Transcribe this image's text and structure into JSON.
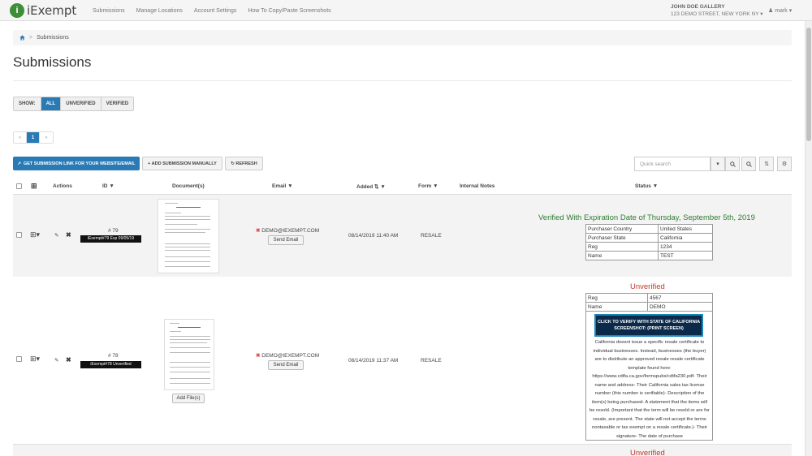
{
  "header": {
    "logo_text": "iExempt",
    "logo_letter": "i",
    "nav": [
      "Submissions",
      "Manage Locations",
      "Account Settings",
      "How To Copy/Paste Screenshots"
    ],
    "gallery_name": "JOHN DOE GALLERY",
    "gallery_address": "123 DEMO STREET, NEW YORK NY ▾",
    "user": "mark ▾"
  },
  "breadcrumb": {
    "current": "Submissions"
  },
  "page_title": "Submissions",
  "filter": {
    "show_label": "SHOW:",
    "options": [
      "ALL",
      "UNVERIFIED",
      "VERIFIED"
    ],
    "active": "ALL"
  },
  "pager": {
    "prev": "«",
    "page": "1",
    "next": "»"
  },
  "toolbar": {
    "get_link": "GET SUBMISSION LINK FOR YOUR WEBSITE/EMAIL",
    "add_manual": "+ ADD SUBMISSION MANUALLY",
    "refresh": "↻ REFRESH",
    "search_placeholder": "Quick search"
  },
  "columns": {
    "actions": "Actions",
    "id": "ID",
    "documents": "Document(s)",
    "email": "Email",
    "added": "Added",
    "form": "Form",
    "notes": "Internal Notes",
    "status": "Status"
  },
  "rows": [
    {
      "id": "# 79",
      "badge": "iExempt#79 Exp 09/05/19",
      "email": "DEMO@IEXEMPT.COM",
      "send_email": "Send Email",
      "added": "08/14/2019 11:40 AM",
      "form": "RESALE",
      "status": "Verified With Expiration Date of Thursday, September 5th, 2019",
      "details": [
        [
          "Purchaser Country",
          "United States"
        ],
        [
          "Purchaser State",
          "California"
        ],
        [
          "Reg",
          "1234"
        ],
        [
          "Name",
          "TEST"
        ]
      ]
    },
    {
      "id": "# 78",
      "badge": "iExempt#78 Unverified",
      "email": "DEMO@IEXEMPT.COM",
      "send_email": "Send Email",
      "add_files": "Add File(s)",
      "added": "08/14/2019 11:37 AM",
      "form": "RESALE",
      "status": "Unverified",
      "details": [
        [
          "Reg",
          "4567"
        ],
        [
          "Name",
          "DEMO"
        ]
      ],
      "verify_button": "CLICK TO VERIFY WITH STATE OF CALIFORNIA SCREENSHOT: (PRINT SCREEN)",
      "verify_text": "California doesnt issue a specific resale certificate to individual businesses. Instead, businesses (the buyer) are to distribute an approved resale resale certificate template found here: https://www.cdtfa.ca.gov/formspubs/cdtfa230.pdf- Their name and address- Their California sales tax license number (this number is verifiable)- Description of the item(s) being purchased- A statement that the items will be resold. (Important that the term will be resold or are for resale, are present. The state will not accept the terms nontaxable or tax exempt on a resale certificate.)- Their signature- The date of purchase"
    },
    {
      "status": "Unverified"
    }
  ],
  "colors": {
    "primary": "#2a7ab5",
    "verified": "#2e7d32",
    "unverified": "#c0392b",
    "logo": "#3b8f37"
  }
}
